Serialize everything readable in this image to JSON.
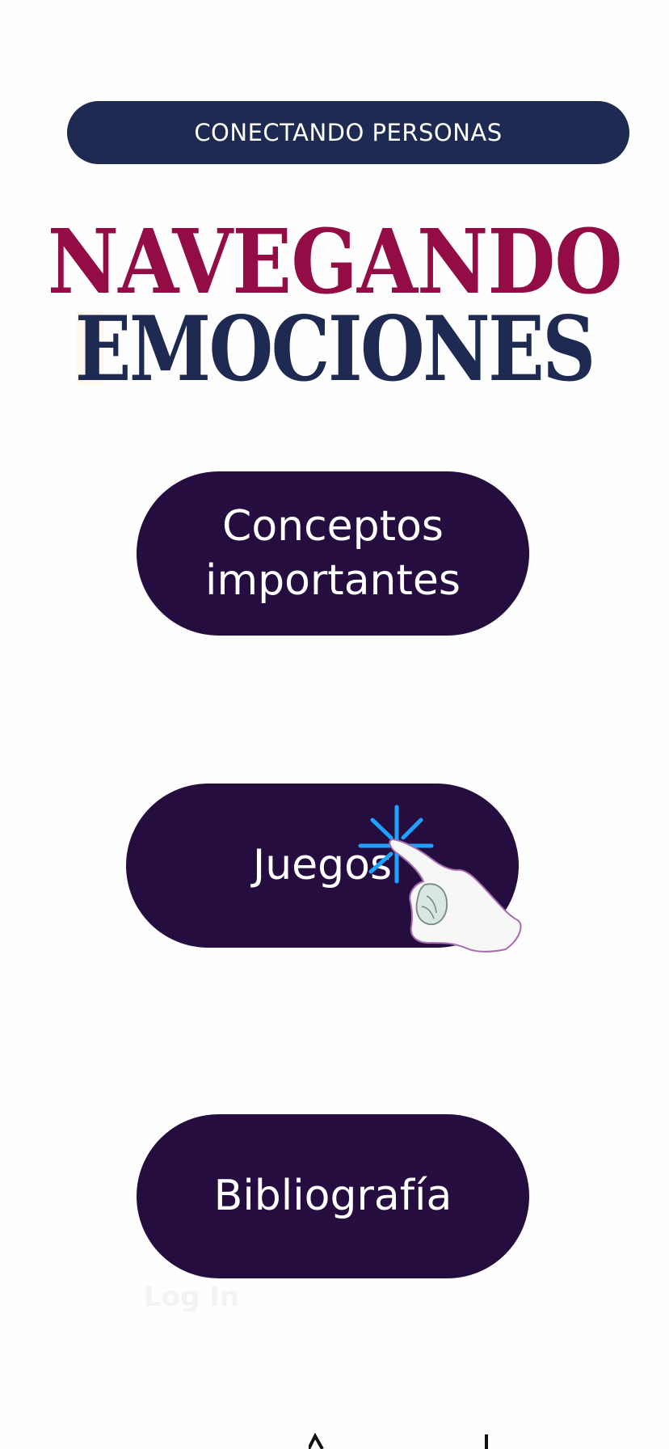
{
  "header": {
    "banner_label": "CONECTANDO PERSONAS"
  },
  "title": {
    "line_1": "NAVEGANDO",
    "line_2": "EMOCIONES",
    "colors": {
      "line_1": "#930c46",
      "line_2": "#1f2a53"
    }
  },
  "menu": {
    "concepts_label": "Conceptos importantes",
    "games_label": "Juegos",
    "bibliography_label": "Bibliografía",
    "button_color": "#250d40"
  },
  "overlay": {
    "tap_icon": "hand-tap-icon"
  },
  "footer": {
    "login_label": "Log In"
  }
}
